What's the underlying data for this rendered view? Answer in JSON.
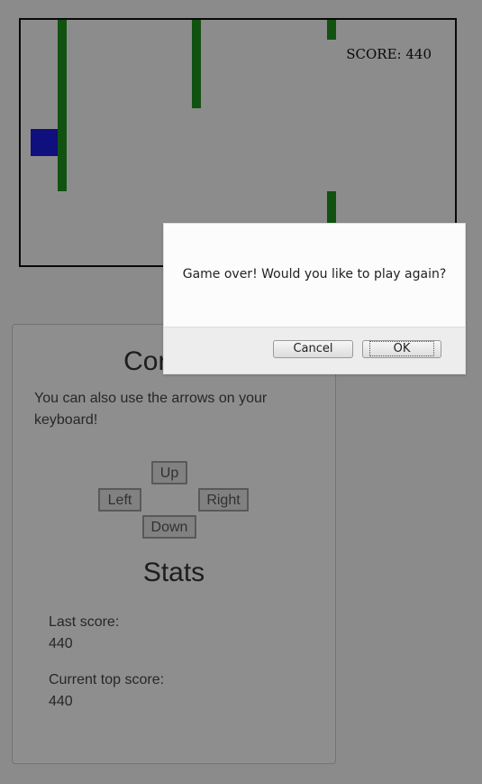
{
  "game": {
    "score_label": "SCORE: 440"
  },
  "controls": {
    "title": "Controls",
    "hint": "You can also use the arrows on your keyboard!",
    "buttons": {
      "up": "Up",
      "left": "Left",
      "right": "Right",
      "down": "Down"
    }
  },
  "stats": {
    "title": "Stats",
    "last_score_label": "Last score:",
    "last_score_value": "440",
    "top_score_label": "Current top score:",
    "top_score_value": "440"
  },
  "dialog": {
    "message": "Game over! Would you like to play again?",
    "cancel_label": "Cancel",
    "ok_label": "OK"
  },
  "colors": {
    "wall": "#1e8e1e",
    "player": "#1b1bd8"
  }
}
